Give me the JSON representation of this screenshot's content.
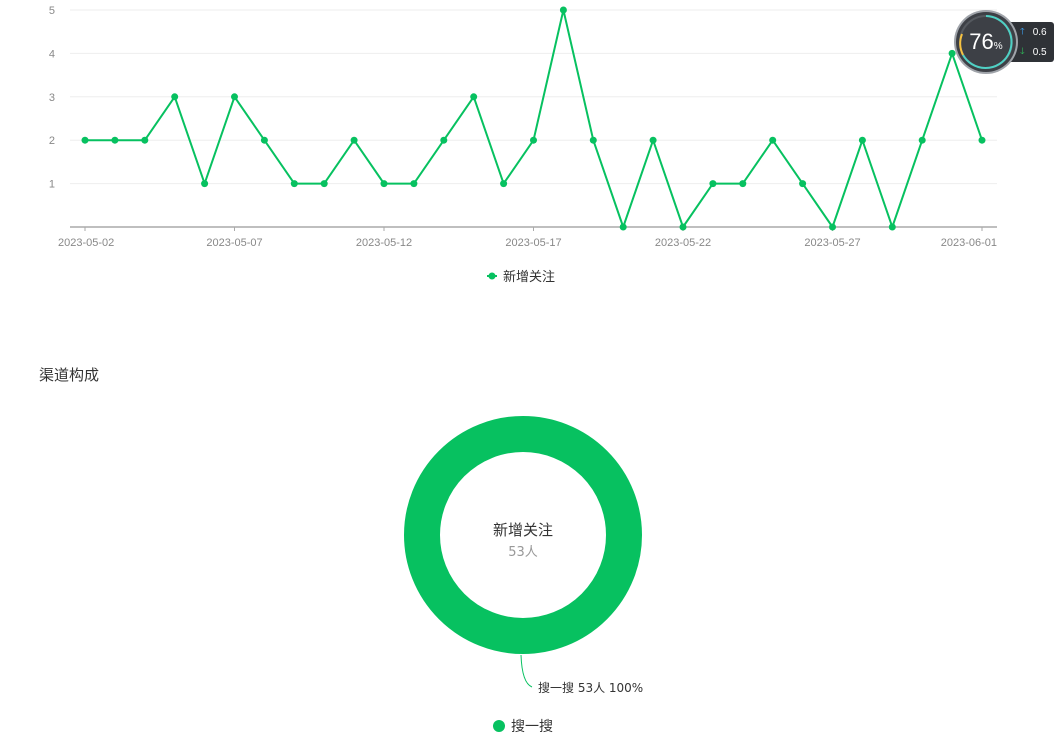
{
  "chart_data": [
    {
      "type": "line",
      "x": [
        "2023-05-02",
        "2023-05-03",
        "2023-05-04",
        "2023-05-05",
        "2023-05-06",
        "2023-05-07",
        "2023-05-08",
        "2023-05-09",
        "2023-05-10",
        "2023-05-11",
        "2023-05-12",
        "2023-05-13",
        "2023-05-14",
        "2023-05-15",
        "2023-05-16",
        "2023-05-17",
        "2023-05-18",
        "2023-05-19",
        "2023-05-20",
        "2023-05-21",
        "2023-05-22",
        "2023-05-23",
        "2023-05-24",
        "2023-05-25",
        "2023-05-26",
        "2023-05-27",
        "2023-05-28",
        "2023-05-29",
        "2023-05-30",
        "2023-05-31",
        "2023-06-01"
      ],
      "x_tick_labels": [
        "2023-05-02",
        "2023-05-07",
        "2023-05-12",
        "2023-05-17",
        "2023-05-22",
        "2023-05-27",
        "2023-06-01"
      ],
      "series": [
        {
          "name": "新增关注",
          "color": "#07c160",
          "values": [
            2,
            2,
            2,
            3,
            1,
            3,
            2,
            1,
            1,
            2,
            1,
            1,
            2,
            3,
            1,
            2,
            5,
            2,
            0,
            2,
            0,
            1,
            1,
            2,
            1,
            0,
            2,
            0,
            2,
            4,
            2
          ]
        }
      ],
      "y_ticks": [
        1,
        2,
        3,
        4,
        5
      ],
      "ylim": [
        0,
        5
      ],
      "grid": true,
      "legend": "bottom-center"
    },
    {
      "type": "pie",
      "title": "渠道构成",
      "center_title": "新增关注",
      "center_value": "53人",
      "slices": [
        {
          "name": "搜一搜",
          "value": 53,
          "percent": "100%",
          "color": "#07c160",
          "label": "搜一搜 53人 100%"
        }
      ],
      "legend": "bottom-center"
    }
  ],
  "perf_widget": {
    "percent": "76",
    "percent_unit": "%",
    "up_value": "0.6",
    "down_value": "0.5"
  }
}
